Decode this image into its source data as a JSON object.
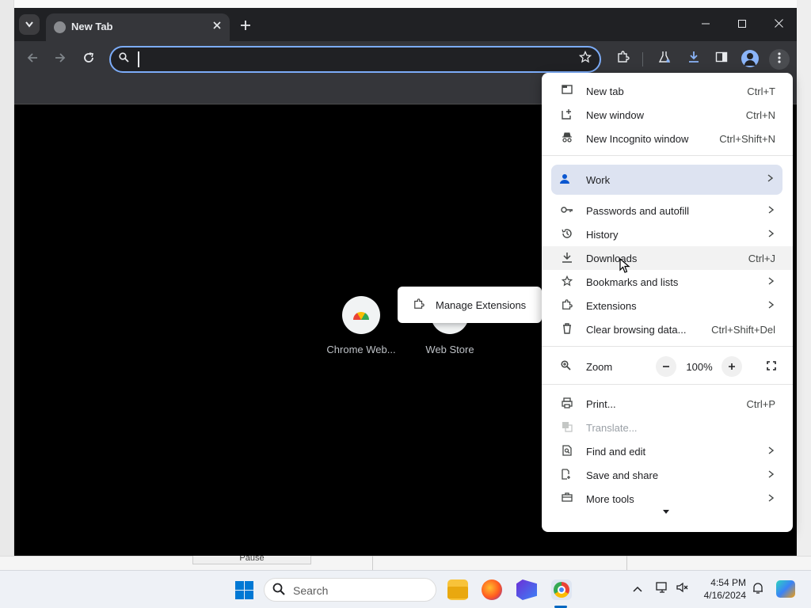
{
  "background": {
    "pause_label": "Pause"
  },
  "browser": {
    "tab": {
      "title": "New Tab"
    },
    "omnibox": {
      "value": "",
      "placeholder": ""
    },
    "shortcuts": [
      {
        "label": "Chrome Web..."
      },
      {
        "label": "Web Store"
      }
    ],
    "extension_popup": {
      "label": "Manage Extensions"
    }
  },
  "menu": {
    "items": {
      "new_tab": {
        "label": "New tab",
        "shortcut": "Ctrl+T"
      },
      "new_window": {
        "label": "New window",
        "shortcut": "Ctrl+N"
      },
      "new_incognito": {
        "label": "New Incognito window",
        "shortcut": "Ctrl+Shift+N"
      },
      "work": {
        "label": "Work"
      },
      "passwords": {
        "label": "Passwords and autofill"
      },
      "history": {
        "label": "History"
      },
      "downloads": {
        "label": "Downloads",
        "shortcut": "Ctrl+J"
      },
      "bookmarks": {
        "label": "Bookmarks and lists"
      },
      "extensions": {
        "label": "Extensions"
      },
      "clear_data": {
        "label": "Clear browsing data...",
        "shortcut": "Ctrl+Shift+Del"
      },
      "zoom": {
        "label": "Zoom",
        "value": "100%"
      },
      "print": {
        "label": "Print...",
        "shortcut": "Ctrl+P"
      },
      "translate": {
        "label": "Translate..."
      },
      "find_edit": {
        "label": "Find and edit"
      },
      "save_share": {
        "label": "Save and share"
      },
      "more_tools": {
        "label": "More tools"
      }
    }
  },
  "taskbar": {
    "search_label": "Search",
    "time": "4:54 PM",
    "date": "4/16/2024"
  },
  "colors": {
    "accent": "#0b57d0",
    "omnibox_focus": "#7cacf8",
    "work_highlight": "#dde3f1",
    "taskbar_active": "#0067c0"
  }
}
